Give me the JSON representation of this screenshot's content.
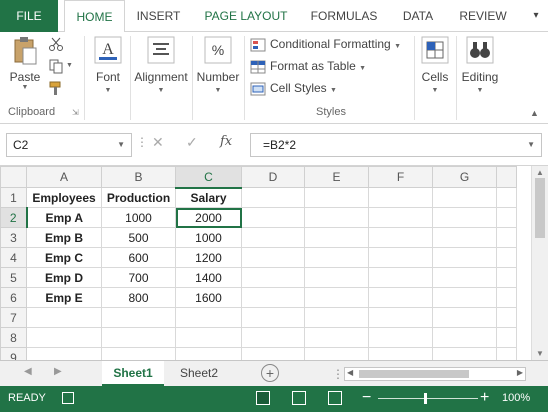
{
  "ribbon_tabs": [
    "FILE",
    "HOME",
    "INSERT",
    "PAGE LAYOUT",
    "FORMULAS",
    "DATA",
    "REVIEW",
    "▾"
  ],
  "ribbon": {
    "paste_label": "Paste",
    "clipboard_label": "Clipboard",
    "font_label": "Font",
    "alignment_label": "Alignment",
    "number_label": "Number",
    "conditional_formatting": "Conditional Formatting",
    "format_as_table": "Format as Table",
    "cell_styles": "Cell Styles",
    "styles_label": "Styles",
    "cells_label": "Cells",
    "editing_label": "Editing"
  },
  "formula_bar": {
    "name_box": "C2",
    "fx": "fx",
    "formula": "=B2*2"
  },
  "grid": {
    "columns": [
      "A",
      "B",
      "C",
      "D",
      "E",
      "F",
      "G",
      ""
    ],
    "rows": [
      {
        "num": "1",
        "cells": [
          "Employees",
          "Production",
          "Salary",
          "",
          "",
          "",
          "",
          ""
        ]
      },
      {
        "num": "2",
        "cells": [
          "Emp A",
          "1000",
          "2000",
          "",
          "",
          "",
          "",
          ""
        ]
      },
      {
        "num": "3",
        "cells": [
          "Emp B",
          "500",
          "1000",
          "",
          "",
          "",
          "",
          ""
        ]
      },
      {
        "num": "4",
        "cells": [
          "Emp C",
          "600",
          "1200",
          "",
          "",
          "",
          "",
          ""
        ]
      },
      {
        "num": "5",
        "cells": [
          "Emp D",
          "700",
          "1400",
          "",
          "",
          "",
          "",
          ""
        ]
      },
      {
        "num": "6",
        "cells": [
          "Emp E",
          "800",
          "1600",
          "",
          "",
          "",
          "",
          ""
        ]
      },
      {
        "num": "7",
        "cells": [
          "",
          "",
          "",
          "",
          "",
          "",
          "",
          ""
        ]
      },
      {
        "num": "8",
        "cells": [
          "",
          "",
          "",
          "",
          "",
          "",
          "",
          ""
        ]
      },
      {
        "num": "9",
        "cells": [
          "",
          "",
          "",
          "",
          "",
          "",
          "",
          ""
        ]
      }
    ],
    "active_cell": "C2"
  },
  "sheets": {
    "tabs": [
      "Sheet1",
      "Sheet2"
    ],
    "add": "+"
  },
  "status": {
    "text": "READY",
    "zoom_minus": "−",
    "zoom_plus": "+",
    "zoom": "100%"
  },
  "colors": {
    "accent": "#217346"
  }
}
